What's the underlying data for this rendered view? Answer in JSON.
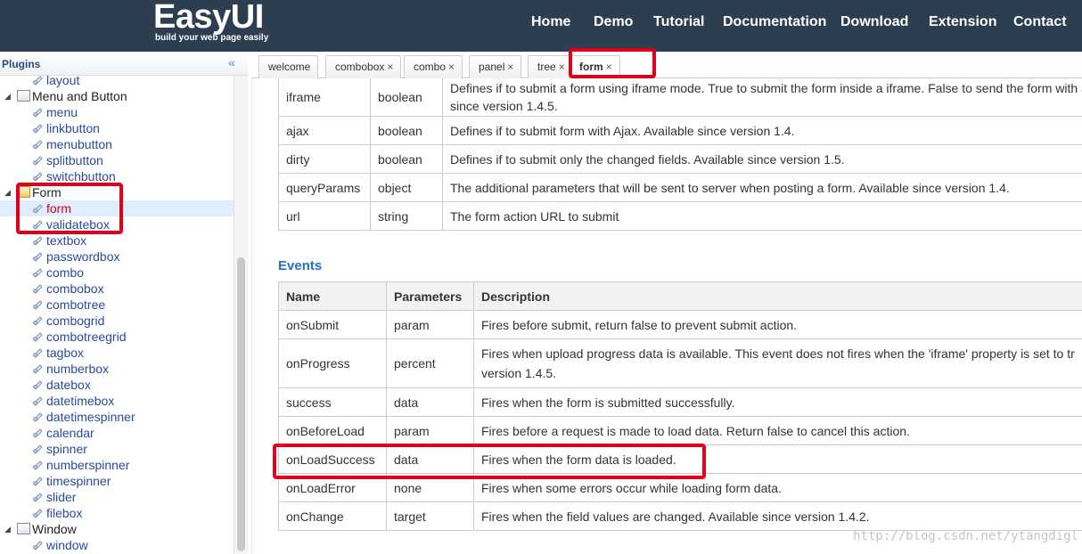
{
  "header": {
    "logo": "EasyUI",
    "tagline": "build your web page easily",
    "nav": [
      "Home",
      "Demo",
      "Tutorial",
      "Documentation",
      "Download",
      "Extension",
      "Contact"
    ]
  },
  "sidebar": {
    "title": "Plugins",
    "collapse_glyph": "«",
    "tree": [
      {
        "label": "layout",
        "type": "leaf"
      },
      {
        "label": "Menu and Button",
        "type": "parent"
      },
      {
        "label": "menu",
        "type": "leaf"
      },
      {
        "label": "linkbutton",
        "type": "leaf"
      },
      {
        "label": "menubutton",
        "type": "leaf"
      },
      {
        "label": "splitbutton",
        "type": "leaf"
      },
      {
        "label": "switchbutton",
        "type": "leaf"
      },
      {
        "label": "Form",
        "type": "parent-open"
      },
      {
        "label": "form",
        "type": "leaf",
        "selected": true
      },
      {
        "label": "validatebox",
        "type": "leaf"
      },
      {
        "label": "textbox",
        "type": "leaf"
      },
      {
        "label": "passwordbox",
        "type": "leaf"
      },
      {
        "label": "combo",
        "type": "leaf"
      },
      {
        "label": "combobox",
        "type": "leaf"
      },
      {
        "label": "combotree",
        "type": "leaf"
      },
      {
        "label": "combogrid",
        "type": "leaf"
      },
      {
        "label": "combotreegrid",
        "type": "leaf"
      },
      {
        "label": "tagbox",
        "type": "leaf"
      },
      {
        "label": "numberbox",
        "type": "leaf"
      },
      {
        "label": "datebox",
        "type": "leaf"
      },
      {
        "label": "datetimebox",
        "type": "leaf"
      },
      {
        "label": "datetimespinner",
        "type": "leaf"
      },
      {
        "label": "calendar",
        "type": "leaf"
      },
      {
        "label": "spinner",
        "type": "leaf"
      },
      {
        "label": "numberspinner",
        "type": "leaf"
      },
      {
        "label": "timespinner",
        "type": "leaf"
      },
      {
        "label": "slider",
        "type": "leaf"
      },
      {
        "label": "filebox",
        "type": "leaf"
      },
      {
        "label": "Window",
        "type": "parent"
      },
      {
        "label": "window",
        "type": "leaf"
      }
    ]
  },
  "tabs": [
    {
      "label": "welcome",
      "closable": false
    },
    {
      "label": "combobox",
      "closable": true
    },
    {
      "label": "combo",
      "closable": true
    },
    {
      "label": "panel",
      "closable": true
    },
    {
      "label": "tree",
      "closable": true
    },
    {
      "label": "form",
      "closable": true,
      "active": true
    }
  ],
  "tab_close_glyph": "×",
  "properties_table": {
    "rows": [
      {
        "name": "iframe",
        "type": "boolean",
        "desc1": "Defines if to submit a form using iframe mode. True to submit the form inside a iframe. False to send the form with a",
        "desc2": "since version 1.4.5."
      },
      {
        "name": "ajax",
        "type": "boolean",
        "desc1": "Defines if to submit form with Ajax. Available since version 1.4."
      },
      {
        "name": "dirty",
        "type": "boolean",
        "desc1": "Defines if to submit only the changed fields. Available since version 1.5."
      },
      {
        "name": "queryParams",
        "type": "object",
        "desc1": "The additional parameters that will be sent to server when posting a form. Available since version 1.4."
      },
      {
        "name": "url",
        "type": "string",
        "desc1": "The form action URL to submit"
      }
    ]
  },
  "events": {
    "title": "Events",
    "headers": [
      "Name",
      "Parameters",
      "Description"
    ],
    "rows": [
      {
        "name": "onSubmit",
        "param": "param",
        "desc1": "Fires before submit, return false to prevent submit action."
      },
      {
        "name": "onProgress",
        "param": "percent",
        "desc1": "Fires when upload progress data is available. This event does not fires when the 'iframe' property is set to tr",
        "desc2": "version 1.4.5."
      },
      {
        "name": "success",
        "param": "data",
        "desc1": "Fires when the form is submitted successfully."
      },
      {
        "name": "onBeforeLoad",
        "param": "param",
        "desc1": "Fires before a request is made to load data. Return false to cancel this action."
      },
      {
        "name": "onLoadSuccess",
        "param": "data",
        "desc1": "Fires when the form data is loaded."
      },
      {
        "name": "onLoadError",
        "param": "none",
        "desc1": "Fires when some errors occur while loading form data."
      },
      {
        "name": "onChange",
        "param": "target",
        "desc1": "Fires when the field values are changed. Available since version 1.4.2."
      }
    ]
  },
  "watermark": "http://blog.csdn.net/ytangdigl",
  "colors": {
    "header_bg": "#2c3e50",
    "link": "#2a4a9a",
    "selected_text": "#d4001a",
    "highlight": "#e0001c",
    "events_title": "#1f6ed0"
  }
}
